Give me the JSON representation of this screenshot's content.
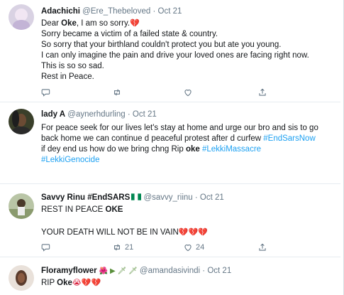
{
  "tweets": [
    {
      "name": "Adachichi",
      "handle": "@Ere_Thebeloved",
      "separator": "·",
      "time": "Oct 21",
      "lines": [
        {
          "pre": "Dear ",
          "bold": "Oke",
          "post": ", I am so sorry.",
          "emoji": "💔"
        },
        {
          "text": "Sorry became a victim of a failed state & country."
        },
        {
          "text": "So sorry that your birthland couldn't protect you but ate you young."
        },
        {
          "text": "I can only imagine the pain and drive your loved ones are facing right now."
        },
        {
          "text": "This is so so sad."
        },
        {
          "text": "Rest in Peace."
        }
      ]
    },
    {
      "name": "lady A",
      "handle": "@aynerhdurling",
      "separator": "·",
      "time": "Oct 21",
      "lines": [
        {
          "text": "For peace seek for our lives let's stay at home and urge our bro and sis to go"
        },
        {
          "pre": "back home we can continue d peaceful protest after d curfew ",
          "tag": "#EndSarsNow"
        },
        {
          "pre": "if dey end us how do we bring chng Rip ",
          "bold": "oke",
          "tag": " #LekkiMassacre"
        },
        {
          "tag": "#LekkiGenocide"
        }
      ]
    },
    {
      "name": "Savvy Rinu #EndSARS",
      "handle": "@savvy_riinu",
      "separator": "·",
      "time": "Oct 21",
      "lines": [
        {
          "pre": "REST IN PEACE ",
          "bold": "OKE"
        },
        {
          "text": ""
        },
        {
          "text": "YOUR DEATH WILL NOT BE IN VAIN",
          "emoji": "💔💔💔"
        }
      ],
      "retweets": "21",
      "likes": "24"
    },
    {
      "name": "Floramyflower",
      "name_emoji": "🌺 ▶ 🗡 🗡",
      "handle": "@amandasivindi",
      "separator": "·",
      "time": "Oct 21",
      "lines": [
        {
          "pre": "RIP ",
          "bold": "Oke",
          "emoji": "😭💔💔"
        }
      ]
    }
  ],
  "icons": {
    "reply": "reply-icon",
    "retweet": "retweet-icon",
    "like": "heart-icon",
    "share": "share-icon"
  }
}
